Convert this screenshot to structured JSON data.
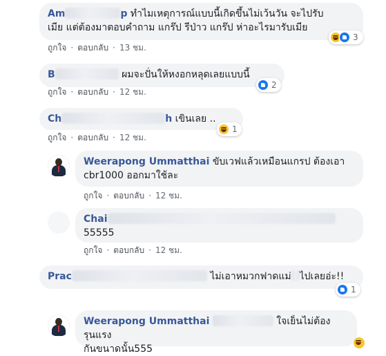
{
  "colors": {
    "bubble": "#f2f3f5",
    "author": "#385898",
    "meta": "#606770",
    "like_blue": "#1877f2",
    "haha_yellow": "#f7c530"
  },
  "comments": [
    {
      "author_visible": "Am",
      "author_tail": "p",
      "text_line1": "ทำไมเหตุการณ์แบบนี้เกิดขึ้นไม่เว้นวัน จะไปรับ",
      "text_line2": "เมีย แต่ต้องมาตอบคำถาม แกร๊ป รีป่าว แกร๊ป ห่าอะไรมารับเมีย",
      "like": "ถูกใจ",
      "reply": "ตอบกลับ",
      "time": "13 ชม.",
      "reaction_icons": [
        "haha-icon",
        "like-icon"
      ],
      "reaction_count": "3"
    },
    {
      "author_visible": "B",
      "text_line1": "ผมจะปั่นให้หงอกหลุดเลยแบบนี้",
      "like": "ถูกใจ",
      "reply": "ตอบกลับ",
      "time": "12 ชม.",
      "reaction_icons": [
        "like-icon"
      ],
      "reaction_count": "2"
    },
    {
      "author_visible": "Ch",
      "author_tail": "h",
      "text_line1": "เขินเลย ..",
      "like": "ถูกใจ",
      "reply": "ตอบกลับ",
      "time": "12 ชม.",
      "reaction_icons": [
        "haha-icon"
      ],
      "reaction_count": "1"
    },
    {
      "author": "Weerapong Ummatthai",
      "text_line1": "ขับเวฟแล้วเหมือนแกรป ต้องเอา",
      "text_line2": "cbr1000 ออกมาใช้ละ",
      "like": "ถูกใจ",
      "reply": "ตอบกลับ",
      "time": "12 ชม."
    },
    {
      "author_visible": "Chai",
      "text_line1": "55555",
      "like": "ถูกใจ",
      "reply": "ตอบกลับ",
      "time": "12 ชม."
    },
    {
      "author_visible": "Prac",
      "text_line1": "ไม่เอาหมวกฟาดแม่",
      "text_line1b": "ไปเลยอ่ะ!!",
      "reaction_icons": [
        "like-icon"
      ],
      "reaction_count": "1"
    },
    {
      "author": "Weerapong Ummatthai",
      "text_line1": "ใจเย็นไม่ต้องรุนแรง",
      "text_line2": "กันขนาดนั้น555"
    }
  ]
}
